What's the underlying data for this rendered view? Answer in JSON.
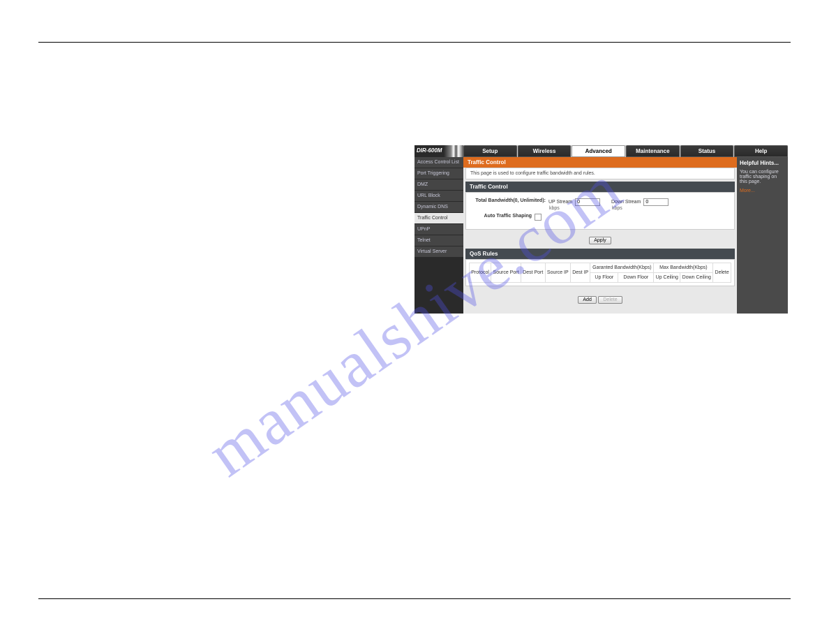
{
  "watermark": "manualshive.com",
  "brand": "DIR-600M",
  "tabs": [
    "Setup",
    "Wireless",
    "Advanced",
    "Maintenance",
    "Status",
    "Help"
  ],
  "activeTab": "Advanced",
  "sidebar": [
    "Access Control List",
    "Port Triggering",
    "DMZ",
    "URL Block",
    "Dynamic DNS",
    "Traffic Control",
    "UPnP",
    "Telnet",
    "Virtual Server"
  ],
  "activeSidebar": "Traffic Control",
  "page": {
    "title": "Traffic Control",
    "desc": "This page is used to configure traffic bandwidth and rules."
  },
  "section1": {
    "header": "Traffic Control",
    "totalLabel": "Total Bandwidth(0, Unlimited):",
    "upLabel": "UP Stream",
    "upValue": "0",
    "upUnit": "kbps",
    "downLabel": "Down Stream",
    "downValue": "0",
    "downUnit": "kbps",
    "autoLabel": "Auto Traffic Shaping"
  },
  "applyLabel": "Apply",
  "section2": {
    "header": "QoS Rules",
    "cols": {
      "protocol": "Protocol",
      "srcPort": "Source Port",
      "dstPort": "Dest Port",
      "srcIp": "Source IP",
      "dstIp": "Dest IP",
      "guaranteed": "Garanted Bandwidth(Kbps)",
      "upFloor": "Up Floor",
      "downFloor": "Down Floor",
      "max": "Max Bandwidth(Kbps)",
      "upCeil": "Up Ceiling",
      "downCeil": "Down Ceiling",
      "delete": "Delete"
    }
  },
  "addLabel": "Add",
  "deleteLabel": "Delete",
  "hints": {
    "title": "Helpful Hints...",
    "body": "You can configure traffic shaping on this page.",
    "more": "More..."
  }
}
